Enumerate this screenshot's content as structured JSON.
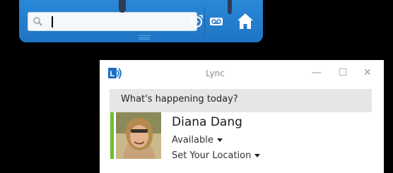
{
  "search": {
    "value": "",
    "placeholder": "",
    "icon": "search-icon"
  },
  "toolbar": {
    "buttons": [
      {
        "name": "recent-calls",
        "icon": "clock-arrow-icon"
      },
      {
        "name": "voicemail",
        "icon": "voicemail-icon"
      },
      {
        "name": "home",
        "icon": "home-icon"
      }
    ],
    "color": "#2a88d8"
  },
  "window": {
    "title": "Lync",
    "minimize": "—",
    "maximize": "☐",
    "close": "✕"
  },
  "status_note": "What's happening today?",
  "user": {
    "name": "Diana Dang",
    "presence": "Available",
    "location": "Set Your Location",
    "presence_color": "#6dbf2a"
  }
}
